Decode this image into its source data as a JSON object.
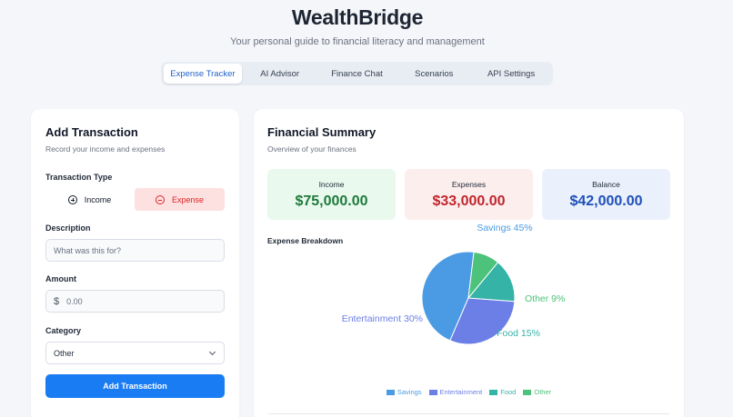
{
  "app": {
    "title": "WealthBridge",
    "subtitle": "Your personal guide to financial literacy and management"
  },
  "tabs": [
    {
      "label": "Expense Tracker",
      "active": true
    },
    {
      "label": "AI Advisor",
      "active": false
    },
    {
      "label": "Finance Chat",
      "active": false
    },
    {
      "label": "Scenarios",
      "active": false
    },
    {
      "label": "API Settings",
      "active": false
    }
  ],
  "add_transaction": {
    "title": "Add Transaction",
    "subtitle": "Record your income and expenses",
    "type_label": "Transaction Type",
    "type_income": "Income",
    "type_expense": "Expense",
    "selected_type": "Expense",
    "description_label": "Description",
    "description_placeholder": "What was this for?",
    "amount_label": "Amount",
    "amount_prefix": "$",
    "amount_placeholder": "0.00",
    "category_label": "Category",
    "category_value": "Other",
    "submit_label": "Add Transaction"
  },
  "summary": {
    "title": "Financial Summary",
    "subtitle": "Overview of your finances",
    "income_label": "Income",
    "income_value": "$75,000.00",
    "expenses_label": "Expenses",
    "expenses_value": "$33,000.00",
    "balance_label": "Balance",
    "balance_value": "$42,000.00",
    "breakdown_label": "Expense Breakdown"
  },
  "colors": {
    "income_bg": "#e9f9ee",
    "income_text": "#1e7a3c",
    "expenses_bg": "#fdeeee",
    "expenses_text": "#c0262d",
    "balance_bg": "#eaf1fd",
    "balance_text": "#1f4fb8",
    "accent": "#1a7cf2"
  },
  "chart_data": {
    "type": "pie",
    "categories": [
      "Savings",
      "Entertainment",
      "Food",
      "Other"
    ],
    "values": [
      45,
      30,
      15,
      9
    ],
    "labels": [
      "Savings 45%",
      "Entertainment 30%",
      "Food 15%",
      "Other 9%"
    ],
    "colors": [
      "#4a9be4",
      "#6b7fe6",
      "#35b3a6",
      "#4dc27a"
    ],
    "legend_position": "bottom"
  }
}
